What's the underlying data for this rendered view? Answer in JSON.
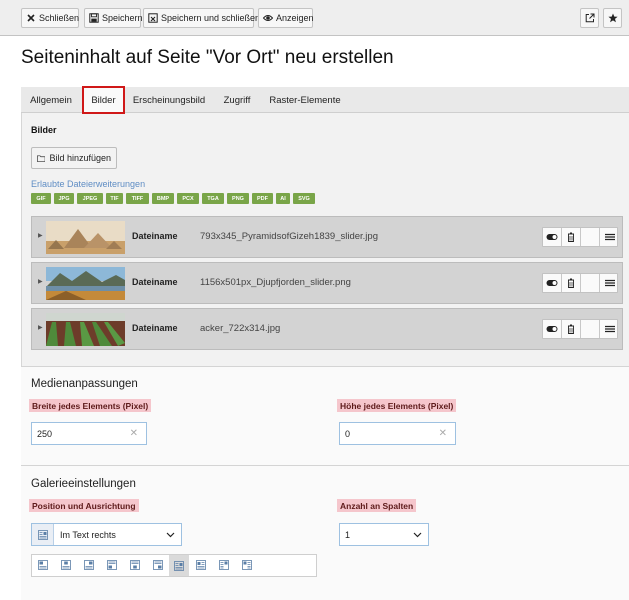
{
  "toolbar": {
    "close_label": "Schließen",
    "save_label": "Speichern",
    "save_close_label": "Speichern und schließen",
    "view_label": "Anzeigen"
  },
  "page_title": "Seiteninhalt auf Seite \"Vor Ort\" neu erstellen",
  "tabs": [
    {
      "label": "Allgemein"
    },
    {
      "label": "Bilder",
      "active": true
    },
    {
      "label": "Erscheinungsbild"
    },
    {
      "label": "Zugriff"
    },
    {
      "label": "Raster-Elemente"
    }
  ],
  "images_section": {
    "heading": "Bilder",
    "add_button": "Bild hinzufügen",
    "allowed_link": "Erlaubte Dateierweiterungen",
    "extensions": [
      "GIF",
      "JPG",
      "JPEG",
      "TIF",
      "TIFF",
      "BMP",
      "PCX",
      "TGA",
      "PNG",
      "PDF",
      "AI",
      "SVG"
    ],
    "files": [
      {
        "label": "Dateiname",
        "name": "793x345_PyramidsofGizeh1839_slider.jpg",
        "thumb": "pyramids"
      },
      {
        "label": "Dateiname",
        "name": "1156x501px_Djupfjorden_slider.png",
        "thumb": "fjord"
      },
      {
        "label": "Dateiname",
        "name": "acker_722x314.jpg",
        "thumb": "field"
      }
    ]
  },
  "media": {
    "title": "Medienanpassungen",
    "width_label": "Breite jedes Elements (Pixel)",
    "width_value": "250",
    "height_label": "Höhe jedes Elements (Pixel)",
    "height_value": "0"
  },
  "gallery": {
    "title": "Galerieeinstellungen",
    "position_label": "Position und Ausrichtung",
    "position_value": "Im Text rechts",
    "columns_label": "Anzahl an Spalten",
    "columns_value": "1"
  },
  "colors": {
    "label_highlight": "#f5c6cc",
    "badge_green": "#79a548",
    "active_tab_border": "#d01818",
    "link_blue": "#5f8dc4"
  }
}
